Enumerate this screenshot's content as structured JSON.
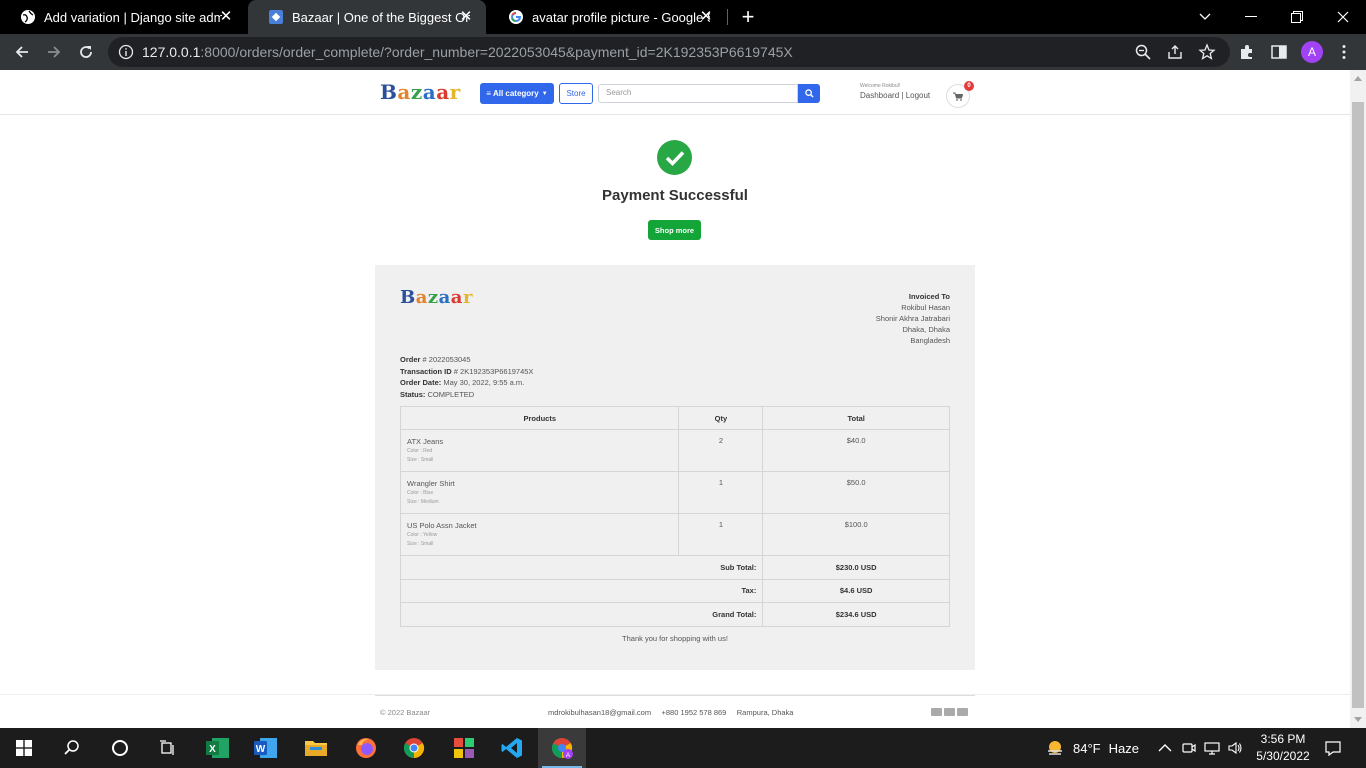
{
  "browser": {
    "tabs": [
      {
        "title": "Add variation | Django site admin",
        "active": false
      },
      {
        "title": "Bazaar | One of the Biggest Online",
        "active": true
      },
      {
        "title": "avatar profile picture - Google Search",
        "active": false
      }
    ],
    "url_host": "127.0.0.1",
    "url_rest": ":8000/orders/order_complete/?order_number=2022053045&payment_id=2K192353P6619745X",
    "profile_initial": "A"
  },
  "header": {
    "logo_letters": [
      "B",
      "a",
      "z",
      "a",
      "a",
      "r"
    ],
    "category_label": "All category",
    "store_label": "Store",
    "search_placeholder": "Search",
    "welcome_text": "Welcome Rokibul!",
    "dashboard_label": "Dashboard",
    "separator": "|",
    "logout_label": "Logout",
    "cart_count": "0"
  },
  "status": {
    "title": "Payment Successful",
    "button_label": "Shop more"
  },
  "invoice": {
    "invoiced_to_label": "Invoiced To",
    "name": "Rokibul Hasan",
    "address1": "Shonir Akhra Jatrabari",
    "address2": "Dhaka, Dhaka",
    "country": "Bangladesh",
    "order_label": "Order",
    "order_value": "# 2022053045",
    "transaction_label": "Transaction ID",
    "transaction_value": "# 2K192353P6619745X",
    "date_label": "Order Date:",
    "date_value": "May 30, 2022, 9:55 a.m.",
    "status_label": "Status:",
    "status_value": "COMPLETED",
    "columns": [
      "Products",
      "Qty",
      "Total"
    ],
    "items": [
      {
        "name": "ATX Jeans",
        "color": "Color : Red",
        "size": "Size : Small",
        "qty": "2",
        "total": "$40.0"
      },
      {
        "name": "Wrangler Shirt",
        "color": "Color : Blue",
        "size": "Size : Medium",
        "qty": "1",
        "total": "$50.0"
      },
      {
        "name": "US Polo Assn Jacket",
        "color": "Color : Yellow",
        "size": "Size : Small",
        "qty": "1",
        "total": "$100.0"
      }
    ],
    "subtotal_label": "Sub Total:",
    "subtotal_value": "$230.0 USD",
    "tax_label": "Tax:",
    "tax_value": "$4.6 USD",
    "grand_label": "Grand Total:",
    "grand_value": "$234.6 USD",
    "thanks": "Thank you for shopping with us!"
  },
  "footer": {
    "copyright": "© 2022 Bazaar",
    "contact": "mdrokibulhasan18@gmail.com     +880 1952 578 869     Rampura, Dhaka"
  },
  "taskbar": {
    "weather_temp": "84°F",
    "weather_desc": "Haze",
    "time": "3:56 PM",
    "date": "5/30/2022"
  },
  "colors": {
    "primary": "#3167eb",
    "success": "#28a745",
    "shop_more": "#13a538",
    "badge": "#e23b3b"
  }
}
